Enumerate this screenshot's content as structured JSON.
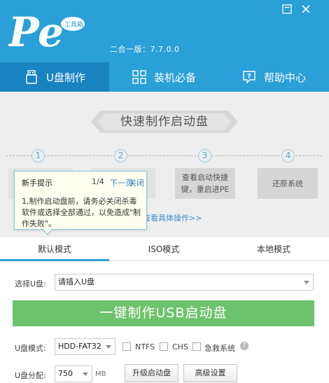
{
  "header": {
    "version": "二合一版：7.7.0.0",
    "logo_text": "Pe",
    "logo_badge": "工具箱"
  },
  "nav": {
    "tabs": [
      {
        "label": "U盘制作",
        "icon": "usb-drive-icon",
        "active": true
      },
      {
        "label": "装机必备",
        "icon": "apps-grid-icon",
        "active": false
      },
      {
        "label": "帮助中心",
        "icon": "help-icon",
        "active": false
      }
    ]
  },
  "hero": {
    "title": "快速制作启动盘",
    "steps": [
      {
        "num": "1",
        "text": ""
      },
      {
        "num": "2",
        "text": ""
      },
      {
        "num": "3",
        "text": "查看启动快捷键，重启进PE"
      },
      {
        "num": "4",
        "text": "还原系统"
      }
    ],
    "detail_link": "查看具体操作>>"
  },
  "tooltip": {
    "title": "新手提示",
    "page": "1/4",
    "next": "下一页",
    "close": "关闭",
    "body": "1,制作启动盘前，请务必关闭杀毒软件或选择全部通过，以免造成\"制作失败\"。"
  },
  "modes": {
    "tabs": [
      {
        "label": "默认模式",
        "active": true
      },
      {
        "label": "ISO模式",
        "active": false
      },
      {
        "label": "本地模式",
        "active": false
      }
    ]
  },
  "form": {
    "usb_label": "选择U盘:",
    "usb_value": "请插入U盘",
    "make_button": "一键制作USB启动盘",
    "format_label": "U盘模式:",
    "format_value": "HDD-FAT32",
    "ntfs": "NTFS",
    "chs": "CHS",
    "rescue": "急救系统",
    "help_mark": "?",
    "alloc_label": "U盘分配:",
    "alloc_value": "750",
    "alloc_unit": "MB",
    "upgrade_button": "升级启动盘",
    "advanced_button": "高级设置"
  },
  "colors": {
    "brand_blue": "#2a9fd8",
    "active_tab": "#1983c2",
    "make_green": "#6cc36c"
  }
}
